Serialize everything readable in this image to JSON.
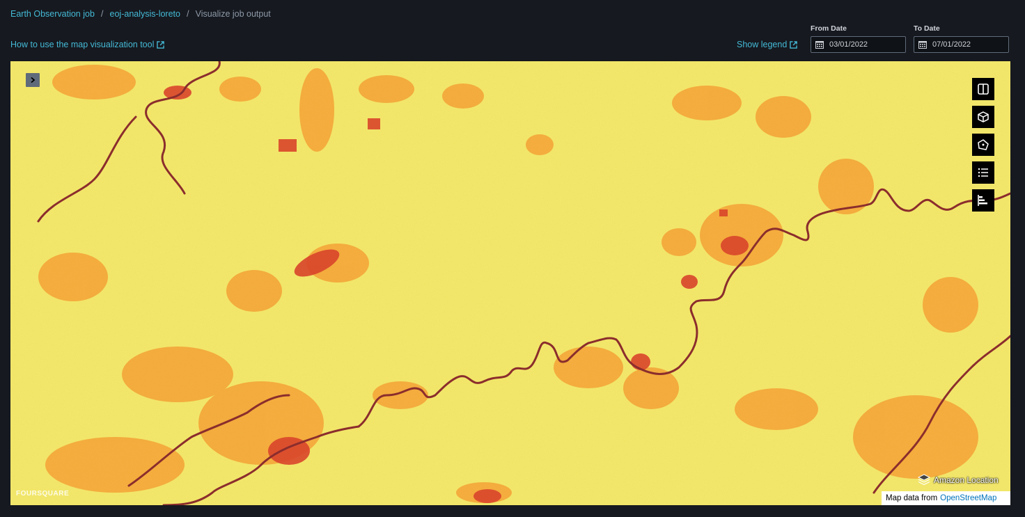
{
  "breadcrumb": {
    "items": [
      "Earth Observation job",
      "eoj-analysis-loreto"
    ],
    "current": "Visualize job output"
  },
  "help_link": "How to use the map visualization tool",
  "legend_link": "Show legend",
  "date_range": {
    "from_label": "From Date",
    "from_value": "03/01/2022",
    "to_label": "To Date",
    "to_value": "07/01/2022"
  },
  "map": {
    "tools": [
      "split-view-icon",
      "3d-cube-icon",
      "polygon-draw-icon",
      "layer-list-icon",
      "bar-chart-icon"
    ],
    "watermark": "FOURSQUARE",
    "provider": "Amazon Location",
    "attribution_prefix": "Map data from",
    "attribution_link": "OpenStreetMap",
    "colors": {
      "base": "#f0e463",
      "patch": "#f4a236",
      "river": "#8b2d2d",
      "hot": "#d9452b"
    }
  }
}
